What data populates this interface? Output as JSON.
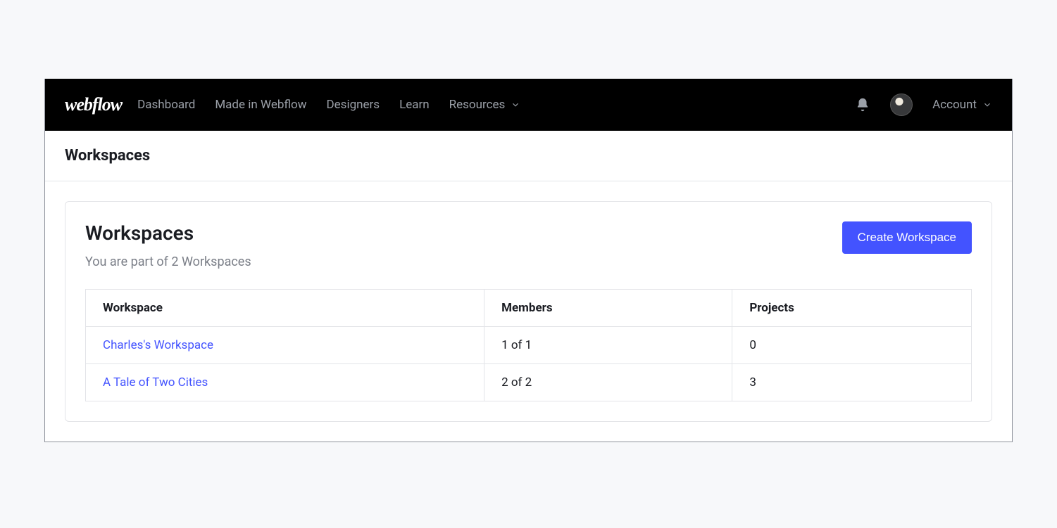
{
  "topbar": {
    "logo": "webflow",
    "nav": {
      "dashboard": "Dashboard",
      "made_in": "Made in Webflow",
      "designers": "Designers",
      "learn": "Learn",
      "resources": "Resources"
    },
    "account": "Account"
  },
  "subheader": {
    "title": "Workspaces"
  },
  "panel": {
    "title": "Workspaces",
    "subtitle": "You are part of 2 Workspaces",
    "create_label": "Create Workspace",
    "columns": {
      "workspace": "Workspace",
      "members": "Members",
      "projects": "Projects"
    },
    "rows": [
      {
        "name": "Charles's Workspace",
        "members": "1 of 1",
        "projects": "0"
      },
      {
        "name": "A Tale of Two Cities",
        "members": "2 of 2",
        "projects": "3"
      }
    ]
  }
}
